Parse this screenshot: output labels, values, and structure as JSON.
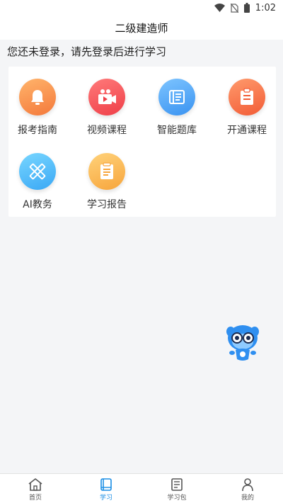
{
  "status_bar": {
    "time": "1:02",
    "icons": [
      "wifi-icon",
      "no-sim-icon",
      "battery-icon"
    ]
  },
  "header": {
    "title": "二级建造师"
  },
  "login_tip": "您还未登录，请先登录后进行学习",
  "menu": [
    {
      "label": "报考指南",
      "icon": "bell-icon",
      "color_from": "#ffb46b",
      "color_to": "#f4793b"
    },
    {
      "label": "视频课程",
      "icon": "video-camera-icon",
      "color_from": "#ff7a7a",
      "color_to": "#ef3f48"
    },
    {
      "label": "智能题库",
      "icon": "question-book-icon",
      "color_from": "#7dc4ff",
      "color_to": "#3a93f1"
    },
    {
      "label": "开通课程",
      "icon": "clipboard-icon",
      "color_from": "#ff9a6c",
      "color_to": "#f25c36"
    },
    {
      "label": "AI教务",
      "icon": "pencil-ruler-icon",
      "color_from": "#78d6ff",
      "color_to": "#3aa8f5"
    },
    {
      "label": "学习报告",
      "icon": "report-icon",
      "color_from": "#ffd27a",
      "color_to": "#f7a53c"
    }
  ],
  "tabs": [
    {
      "label": "首页",
      "icon": "home-icon",
      "active": false
    },
    {
      "label": "学习",
      "icon": "book-icon",
      "active": true
    },
    {
      "label": "学习包",
      "icon": "package-icon",
      "active": false
    },
    {
      "label": "我的",
      "icon": "user-icon",
      "active": false
    }
  ],
  "colors": {
    "accent": "#1a8ee5",
    "background": "#f4f5f7"
  }
}
